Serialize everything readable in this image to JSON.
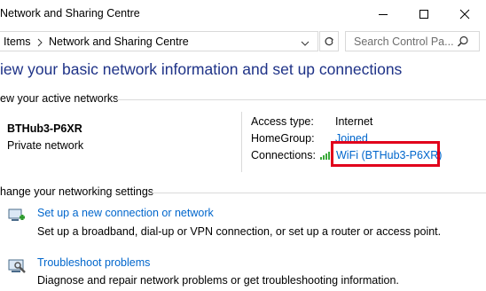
{
  "window": {
    "title": "Network and Sharing Centre"
  },
  "address": {
    "crumbs": [
      "Items",
      "Network and Sharing Centre"
    ],
    "search_placeholder": "Search Control Pa..."
  },
  "page": {
    "heading": "iew your basic network information and set up connections"
  },
  "active_networks": {
    "header": "ew your active networks",
    "name": "BTHub3-P6XR",
    "type": "Private network",
    "access_type_label": "Access type:",
    "access_type_value": "Internet",
    "homegroup_label": "HomeGroup:",
    "homegroup_value": "Joined",
    "connections_label": "Connections:",
    "connections_value": "WiFi (BTHub3-P6XR)"
  },
  "settings": {
    "header": "hange your networking settings",
    "tasks": [
      {
        "title": "Set up a new connection or network",
        "desc": "Set up a broadband, dial-up or VPN connection, or set up a router or access point.",
        "icon": "network-setup-icon"
      },
      {
        "title": "Troubleshoot problems",
        "desc": "Diagnose and repair network problems or get troubleshooting information.",
        "icon": "troubleshoot-icon"
      }
    ]
  },
  "colors": {
    "link": "#0066cc",
    "heading": "#1e3287",
    "highlight": "#e1001b"
  }
}
